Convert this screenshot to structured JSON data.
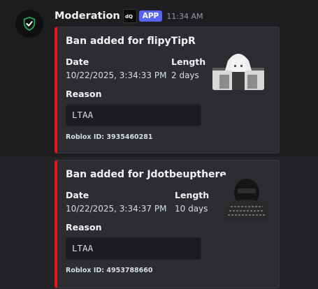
{
  "message": {
    "username": "Moderation",
    "bot_tag": "APP",
    "timestamp": "11:34 AM",
    "bot_logo_text": "dQ",
    "accent": "#e8161b",
    "avatar_color": "#23a55a"
  },
  "embeds": [
    {
      "title": "Ban added for flipyTipR",
      "date_label": "Date",
      "date_value": "10/22/2025, 3:34:33 PM",
      "length_label": "Length",
      "length_value": "2 days",
      "reason_label": "Reason",
      "reason_value": "LTAA",
      "footer": "Roblox ID: 3935460281",
      "thumbnail": "white-haired-avatar"
    },
    {
      "title": "Ban added for Jdotbeupthere",
      "date_label": "Date",
      "date_value": "10/22/2025, 3:34:37 PM",
      "length_label": "Length",
      "length_value": "10 days",
      "reason_label": "Reason",
      "reason_value": "LTAA",
      "footer": "Roblox ID: 4953788660",
      "thumbnail": "masked-avatar"
    }
  ]
}
